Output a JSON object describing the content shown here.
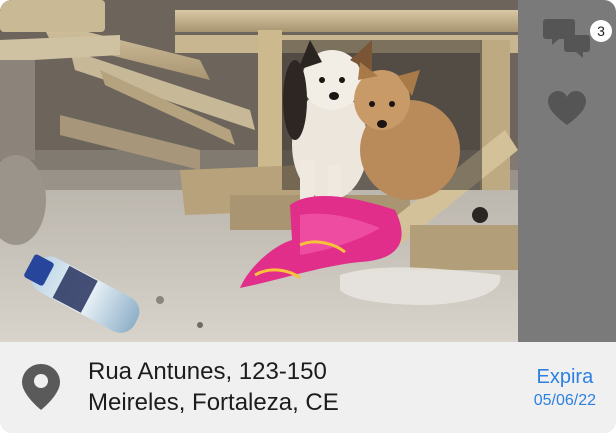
{
  "post": {
    "photo_subject": "puppies-photo",
    "comment_count": "3",
    "address_line1": "Rua Antunes, 123-150",
    "address_line2": "Meireles, Fortaleza, CE",
    "expires_label": "Expira",
    "expires_date": "05/06/22"
  },
  "icons": {
    "comments": "chat-bubbles-icon",
    "like": "heart-icon",
    "location": "map-pin-icon"
  },
  "colors": {
    "side_panel": "#7a7a7a",
    "footer_bg": "#f0f0f0",
    "accent_blue": "#2d7fe0",
    "text_dark": "#1c1c1c",
    "icon_gray": "#5a5a5a"
  }
}
